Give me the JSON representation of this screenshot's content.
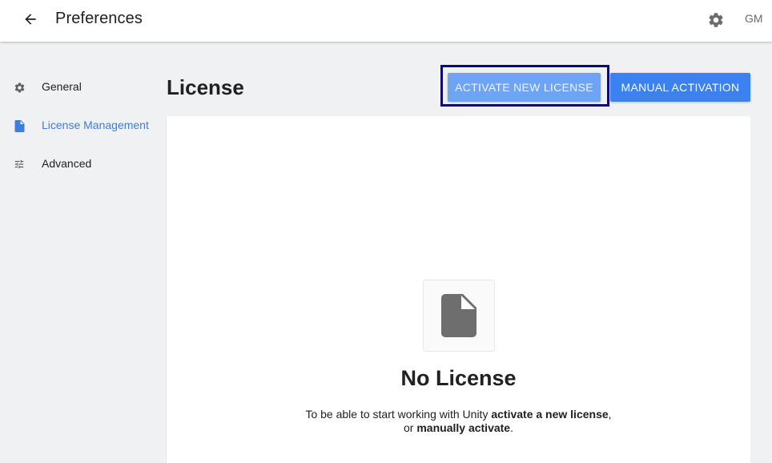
{
  "header": {
    "title": "Preferences",
    "back_icon": "arrow-left-icon",
    "settings_icon": "gear-icon",
    "avatar_initials": "GM"
  },
  "sidebar": {
    "items": [
      {
        "label": "General",
        "icon": "gear-icon",
        "active": false
      },
      {
        "label": "License Management",
        "icon": "file-icon",
        "active": true
      },
      {
        "label": "Advanced",
        "icon": "sliders-icon",
        "active": false
      }
    ]
  },
  "main": {
    "heading": "License",
    "buttons": {
      "activate_new": "ACTIVATE NEW LICENSE",
      "manual": "MANUAL ACTIVATION"
    },
    "empty_state": {
      "icon": "file-icon",
      "title": "No License",
      "desc_prefix": "To be able to start working with Unity ",
      "desc_link1": "activate a new license",
      "desc_middle": ",",
      "desc_line2_prefix": "or ",
      "desc_link2": "manually activate",
      "desc_suffix": "."
    }
  },
  "colors": {
    "accent": "#3b82f0",
    "accent_light": "#6ea4f5",
    "focus_ring": "#0e0a6e",
    "active_nav": "#3d7de0"
  }
}
